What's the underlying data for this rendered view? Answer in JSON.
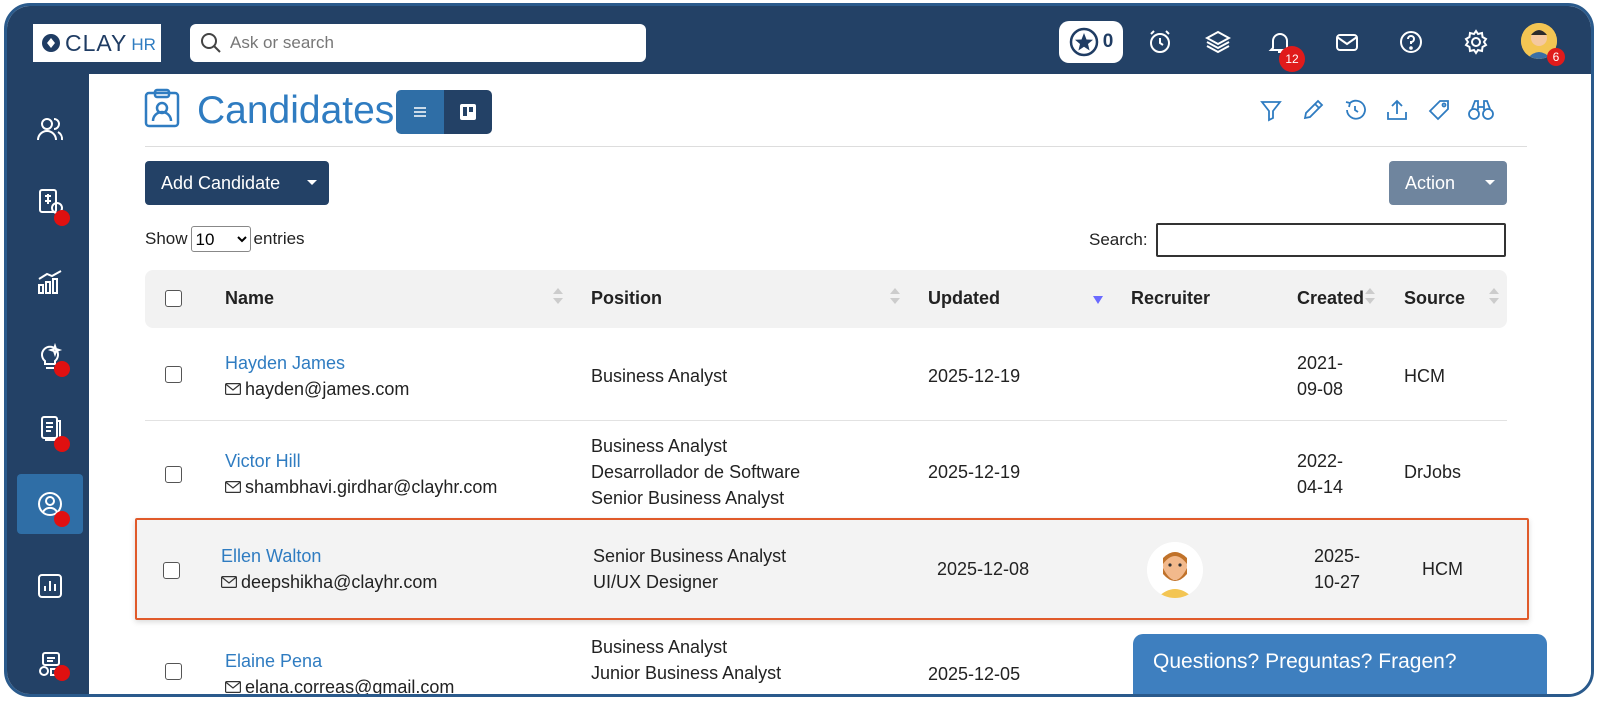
{
  "brand": {
    "name_main": "CLAY",
    "name_sub": "HR"
  },
  "topbar": {
    "search_placeholder": "Ask or search",
    "kudos_count": "0",
    "notifications_count": "12",
    "profile_badge": "6"
  },
  "page": {
    "title": "Candidates"
  },
  "buttons": {
    "add_candidate": "Add Candidate",
    "action": "Action"
  },
  "table_controls": {
    "show_label": "Show",
    "entries_value": "10",
    "entries_options": [
      "10"
    ],
    "entries_label": "entries",
    "search_label": "Search:"
  },
  "table": {
    "columns": [
      "Name",
      "Position",
      "Updated",
      "Recruiter",
      "Created",
      "Source"
    ],
    "rows": [
      {
        "name": "Hayden James",
        "email": "hayden@james.com",
        "positions": [
          "Business Analyst"
        ],
        "updated": "2025-12-19",
        "recruiter_avatar": false,
        "created_line1": "2021-",
        "created_line2": "09-08",
        "source": "HCM"
      },
      {
        "name": "Victor Hill",
        "email": "shambhavi.girdhar@clayhr.com",
        "positions": [
          "Business Analyst",
          "Desarrollador de Software",
          "Senior Business Analyst"
        ],
        "updated": "2025-12-19",
        "recruiter_avatar": false,
        "created_line1": "2022-",
        "created_line2": "04-14",
        "source": "DrJobs"
      },
      {
        "name": "Ellen Walton",
        "email": "deepshikha@clayhr.com",
        "positions": [
          "Senior Business Analyst",
          "UI/UX Designer"
        ],
        "updated": "2025-12-08",
        "recruiter_avatar": true,
        "created_line1": "2025-",
        "created_line2": "10-27",
        "source": "HCM"
      },
      {
        "name": "Elaine Pena",
        "email": "elana.correas@gmail.com",
        "positions": [
          "Business Analyst",
          "Junior Business Analyst"
        ],
        "updated": "2025-12-05",
        "recruiter_avatar": false,
        "created_line1": "",
        "created_line2": "",
        "source": ""
      }
    ]
  },
  "help_chat": {
    "label": "Questions? Preguntas? Fragen?"
  },
  "colors": {
    "navy": "#234166",
    "accent_blue": "#2f7cc1",
    "highlight_border": "#e05a2a",
    "badge_red": "#e01b1b"
  }
}
